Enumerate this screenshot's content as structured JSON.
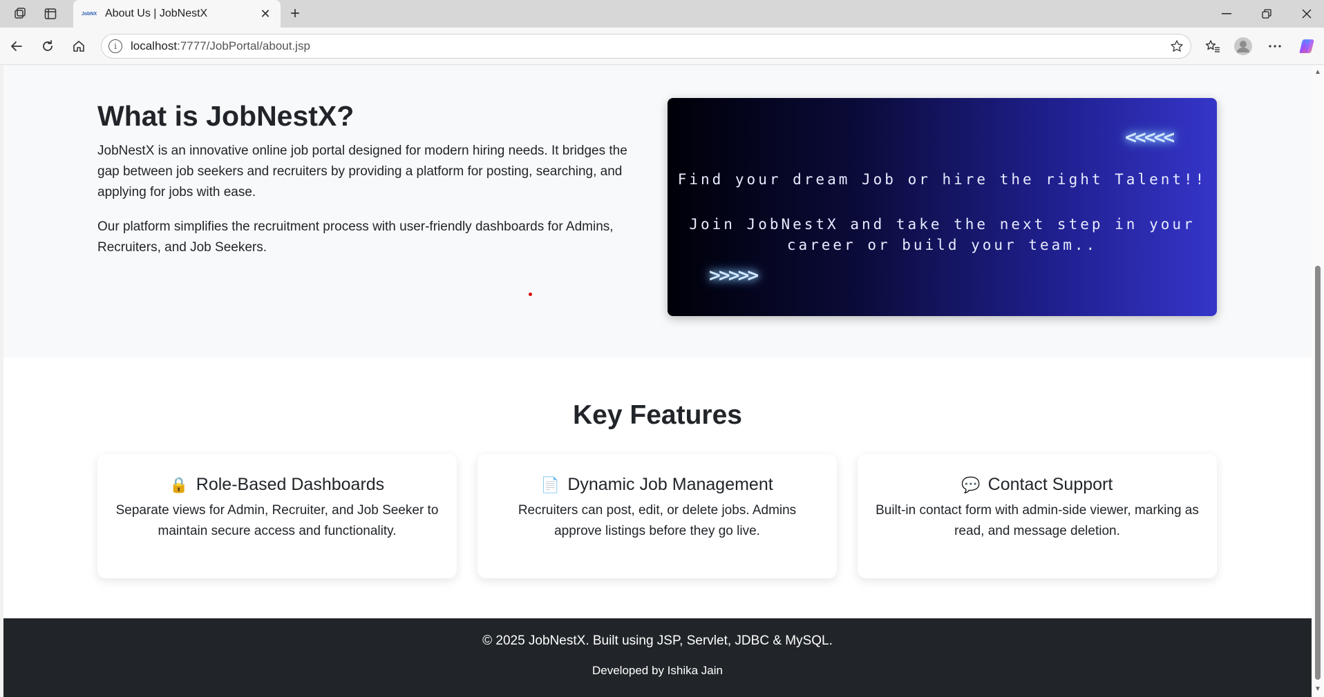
{
  "browser": {
    "tab_title": "About Us | JobNestX",
    "tab_favicon_text": "JobNX",
    "url_host": "localhost",
    "url_path": ":7777/JobPortal/about.jsp"
  },
  "about": {
    "title": "What is JobNestX?",
    "paragraph1": "JobNestX is an innovative online job portal designed for modern hiring needs. It bridges the gap between job seekers and recruiters by providing a platform for posting, searching, and applying for jobs with ease.",
    "paragraph2": "Our platform simplifies the recruitment process with user-friendly dashboards for Admins, Recruiters, and Job Seekers."
  },
  "banner": {
    "arrows_left": "<<<<<",
    "line1": "Find your dream Job or hire the right Talent!!",
    "line2": "Join JobNestX and take the next step in your career or build your team..",
    "arrows_right": ">>>>>"
  },
  "features": {
    "title": "Key Features",
    "cards": [
      {
        "icon": "lock-icon",
        "emoji": "🔒",
        "title": "Role-Based Dashboards",
        "desc": "Separate views for Admin, Recruiter, and Job Seeker to maintain secure access and functionality."
      },
      {
        "icon": "document-icon",
        "emoji": "📄",
        "title": "Dynamic Job Management",
        "desc": "Recruiters can post, edit, or delete jobs. Admins approve listings before they go live."
      },
      {
        "icon": "speech-bubble-icon",
        "emoji": "💬",
        "title": "Contact Support",
        "desc": "Built-in contact form with admin-side viewer, marking as read, and message deletion."
      }
    ]
  },
  "footer": {
    "line1": "© 2025 JobNestX. Built using JSP, Servlet, JDBC & MySQL.",
    "line2": "Developed by Ishika Jain"
  },
  "colors": {
    "footer_bg": "#212529",
    "about_bg": "#f8f9fa",
    "banner_gradient_start": "#000008",
    "banner_gradient_end": "#3535c9"
  }
}
